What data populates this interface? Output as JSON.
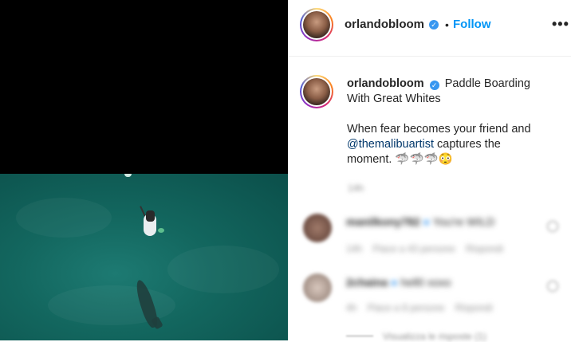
{
  "post": {
    "username": "orlandobloom",
    "follow_label": "Follow",
    "separator": "•",
    "more_label": "•••"
  },
  "caption": {
    "username": "orlandobloom",
    "title": "Paddle Boarding With Great Whites",
    "line1": "When fear becomes your friend and",
    "mention": "@themalibuartist",
    "line2_rest": " captures the",
    "line3": "moment. 🦈🦈🦈😳",
    "age": "14h"
  },
  "comments": [
    {
      "username": "manilkony782",
      "text": "You're WILD",
      "age": "14h",
      "likes": "Piace a 43 persone",
      "reply": "Rispondi"
    },
    {
      "username": "2chaina",
      "text": "hell0 xoxo",
      "age": "4h",
      "likes": "Piace a 8 persone",
      "reply": "Rispondi"
    }
  ],
  "view_replies": "Visualizza le risposte (1)"
}
